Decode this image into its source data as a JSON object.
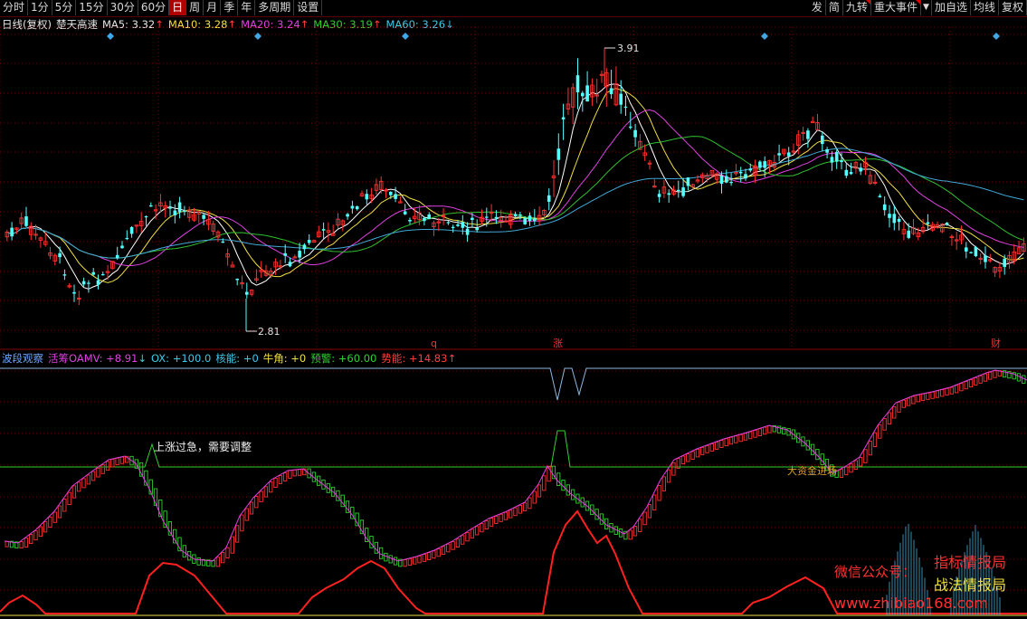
{
  "toolbar": {
    "left": [
      {
        "label": "分时",
        "active": false
      },
      {
        "label": "1分",
        "active": false
      },
      {
        "label": "5分",
        "active": false
      },
      {
        "label": "15分",
        "active": false
      },
      {
        "label": "30分",
        "active": false
      },
      {
        "label": "60分",
        "active": false
      },
      {
        "label": "日",
        "active": true
      },
      {
        "label": "周",
        "active": false
      },
      {
        "label": "月",
        "active": false
      },
      {
        "label": "季",
        "active": false
      },
      {
        "label": "年",
        "active": false
      },
      {
        "label": "多周期",
        "active": false
      },
      {
        "label": "设置",
        "active": false
      }
    ],
    "right": [
      {
        "label": "发"
      },
      {
        "label": "简"
      },
      {
        "label": "九转"
      },
      {
        "label": "重大事件"
      },
      {
        "label": "▼"
      },
      {
        "label": "加自选"
      },
      {
        "label": "均线"
      },
      {
        "label": "复权"
      }
    ]
  },
  "main_info": {
    "period": "日线(复权)",
    "stock": "楚天高速",
    "ma5": "MA5: 3.32",
    "ma5_arrow": "↑",
    "ma10": "MA10: 3.28",
    "ma10_arrow": "↑",
    "ma20": "MA20: 3.24",
    "ma20_arrow": "↑",
    "ma30": "MA30: 3.19",
    "ma30_arrow": "↑",
    "ma60": "MA60: 3.26",
    "ma60_arrow": "↓"
  },
  "indicator_info": {
    "name": "波段观察",
    "hc": "活筹OAMV: +8.91",
    "hc_arrow": "↓",
    "ox": "OX: +100.0",
    "hn": "核能: +0",
    "nj": "牛角: +0",
    "yj": "预警: +60.00",
    "sn": "势能: +14.83",
    "sn_arrow": "↑"
  },
  "price_labels": {
    "high": "3.91",
    "low": "2.81"
  },
  "event_markers": [
    "q",
    "涨",
    "财"
  ],
  "annotations": {
    "overheat": "上涨过急，需要调整",
    "capital": "大资金进场"
  },
  "watermark": {
    "line1": "指标情报局",
    "line2": "战法情报局",
    "wechat": "微信公众号：",
    "url": "www.zhibiao168.com"
  },
  "colors": {
    "up": "#ff3030",
    "down": "#54ffff",
    "ma5": "#ffffff",
    "ma10": "#f0e040",
    "ma20": "#e040e0",
    "ma30": "#30c030",
    "ma60": "#40a8d8",
    "grid": "#7a0000",
    "diamond": "#40a8e8"
  }
}
